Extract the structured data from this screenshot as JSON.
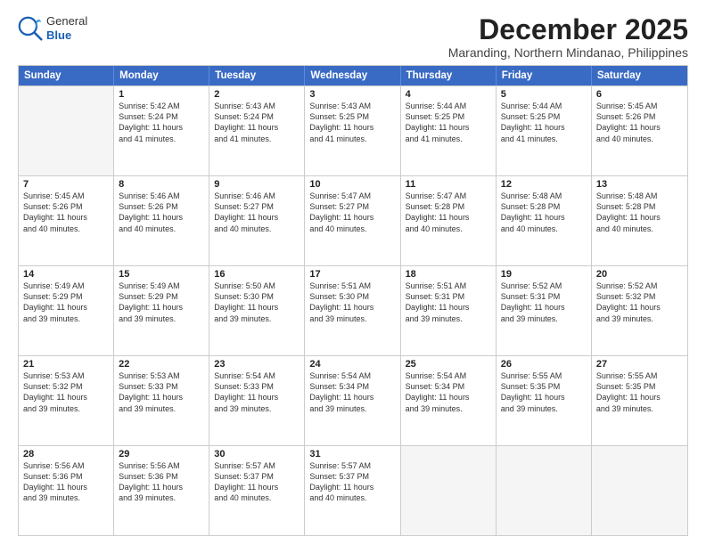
{
  "logo": {
    "general": "General",
    "blue": "Blue"
  },
  "title": "December 2025",
  "location": "Maranding, Northern Mindanao, Philippines",
  "header_days": [
    "Sunday",
    "Monday",
    "Tuesday",
    "Wednesday",
    "Thursday",
    "Friday",
    "Saturday"
  ],
  "weeks": [
    [
      {
        "day": "",
        "text": ""
      },
      {
        "day": "1",
        "text": "Sunrise: 5:42 AM\nSunset: 5:24 PM\nDaylight: 11 hours\nand 41 minutes."
      },
      {
        "day": "2",
        "text": "Sunrise: 5:43 AM\nSunset: 5:24 PM\nDaylight: 11 hours\nand 41 minutes."
      },
      {
        "day": "3",
        "text": "Sunrise: 5:43 AM\nSunset: 5:25 PM\nDaylight: 11 hours\nand 41 minutes."
      },
      {
        "day": "4",
        "text": "Sunrise: 5:44 AM\nSunset: 5:25 PM\nDaylight: 11 hours\nand 41 minutes."
      },
      {
        "day": "5",
        "text": "Sunrise: 5:44 AM\nSunset: 5:25 PM\nDaylight: 11 hours\nand 41 minutes."
      },
      {
        "day": "6",
        "text": "Sunrise: 5:45 AM\nSunset: 5:26 PM\nDaylight: 11 hours\nand 40 minutes."
      }
    ],
    [
      {
        "day": "7",
        "text": "Sunrise: 5:45 AM\nSunset: 5:26 PM\nDaylight: 11 hours\nand 40 minutes."
      },
      {
        "day": "8",
        "text": "Sunrise: 5:46 AM\nSunset: 5:26 PM\nDaylight: 11 hours\nand 40 minutes."
      },
      {
        "day": "9",
        "text": "Sunrise: 5:46 AM\nSunset: 5:27 PM\nDaylight: 11 hours\nand 40 minutes."
      },
      {
        "day": "10",
        "text": "Sunrise: 5:47 AM\nSunset: 5:27 PM\nDaylight: 11 hours\nand 40 minutes."
      },
      {
        "day": "11",
        "text": "Sunrise: 5:47 AM\nSunset: 5:28 PM\nDaylight: 11 hours\nand 40 minutes."
      },
      {
        "day": "12",
        "text": "Sunrise: 5:48 AM\nSunset: 5:28 PM\nDaylight: 11 hours\nand 40 minutes."
      },
      {
        "day": "13",
        "text": "Sunrise: 5:48 AM\nSunset: 5:28 PM\nDaylight: 11 hours\nand 40 minutes."
      }
    ],
    [
      {
        "day": "14",
        "text": "Sunrise: 5:49 AM\nSunset: 5:29 PM\nDaylight: 11 hours\nand 39 minutes."
      },
      {
        "day": "15",
        "text": "Sunrise: 5:49 AM\nSunset: 5:29 PM\nDaylight: 11 hours\nand 39 minutes."
      },
      {
        "day": "16",
        "text": "Sunrise: 5:50 AM\nSunset: 5:30 PM\nDaylight: 11 hours\nand 39 minutes."
      },
      {
        "day": "17",
        "text": "Sunrise: 5:51 AM\nSunset: 5:30 PM\nDaylight: 11 hours\nand 39 minutes."
      },
      {
        "day": "18",
        "text": "Sunrise: 5:51 AM\nSunset: 5:31 PM\nDaylight: 11 hours\nand 39 minutes."
      },
      {
        "day": "19",
        "text": "Sunrise: 5:52 AM\nSunset: 5:31 PM\nDaylight: 11 hours\nand 39 minutes."
      },
      {
        "day": "20",
        "text": "Sunrise: 5:52 AM\nSunset: 5:32 PM\nDaylight: 11 hours\nand 39 minutes."
      }
    ],
    [
      {
        "day": "21",
        "text": "Sunrise: 5:53 AM\nSunset: 5:32 PM\nDaylight: 11 hours\nand 39 minutes."
      },
      {
        "day": "22",
        "text": "Sunrise: 5:53 AM\nSunset: 5:33 PM\nDaylight: 11 hours\nand 39 minutes."
      },
      {
        "day": "23",
        "text": "Sunrise: 5:54 AM\nSunset: 5:33 PM\nDaylight: 11 hours\nand 39 minutes."
      },
      {
        "day": "24",
        "text": "Sunrise: 5:54 AM\nSunset: 5:34 PM\nDaylight: 11 hours\nand 39 minutes."
      },
      {
        "day": "25",
        "text": "Sunrise: 5:54 AM\nSunset: 5:34 PM\nDaylight: 11 hours\nand 39 minutes."
      },
      {
        "day": "26",
        "text": "Sunrise: 5:55 AM\nSunset: 5:35 PM\nDaylight: 11 hours\nand 39 minutes."
      },
      {
        "day": "27",
        "text": "Sunrise: 5:55 AM\nSunset: 5:35 PM\nDaylight: 11 hours\nand 39 minutes."
      }
    ],
    [
      {
        "day": "28",
        "text": "Sunrise: 5:56 AM\nSunset: 5:36 PM\nDaylight: 11 hours\nand 39 minutes."
      },
      {
        "day": "29",
        "text": "Sunrise: 5:56 AM\nSunset: 5:36 PM\nDaylight: 11 hours\nand 39 minutes."
      },
      {
        "day": "30",
        "text": "Sunrise: 5:57 AM\nSunset: 5:37 PM\nDaylight: 11 hours\nand 40 minutes."
      },
      {
        "day": "31",
        "text": "Sunrise: 5:57 AM\nSunset: 5:37 PM\nDaylight: 11 hours\nand 40 minutes."
      },
      {
        "day": "",
        "text": ""
      },
      {
        "day": "",
        "text": ""
      },
      {
        "day": "",
        "text": ""
      }
    ]
  ]
}
